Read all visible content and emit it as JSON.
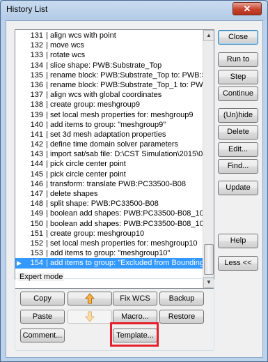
{
  "window": {
    "title": "History List",
    "close_glyph": "✕"
  },
  "history": {
    "separator": "|",
    "selected_marker": "▶",
    "items": [
      {
        "num": "131",
        "text": "align wcs with point"
      },
      {
        "num": "132",
        "text": "move wcs"
      },
      {
        "num": "133",
        "text": "rotate wcs"
      },
      {
        "num": "134",
        "text": "slice shape: PWB:Substrate_Top"
      },
      {
        "num": "135",
        "text": "rename block: PWB:Substrate_Top to: PWB:S"
      },
      {
        "num": "136",
        "text": "rename block: PWB:Substrate_Top_1 to: PWB"
      },
      {
        "num": "137",
        "text": "align wcs with global coordinates"
      },
      {
        "num": "138",
        "text": "create group: meshgroup9"
      },
      {
        "num": "139",
        "text": "set local mesh properties for: meshgroup9"
      },
      {
        "num": "140",
        "text": "add items to group: \"meshgroup9\""
      },
      {
        "num": "141",
        "text": "set 3d mesh adaptation properties"
      },
      {
        "num": "142",
        "text": "define time domain solver parameters"
      },
      {
        "num": "143",
        "text": "import sat/sab file: D:\\CST Simulation\\2015\\05"
      },
      {
        "num": "144",
        "text": "pick circle center point"
      },
      {
        "num": "145",
        "text": "pick circle center point"
      },
      {
        "num": "146",
        "text": "transform: translate PWB:PC33500-B08"
      },
      {
        "num": "147",
        "text": "delete shapes"
      },
      {
        "num": "148",
        "text": "split shape: PWB:PC33500-B08"
      },
      {
        "num": "149",
        "text": "boolean add shapes: PWB:PC33500-B08_10, I"
      },
      {
        "num": "150",
        "text": "boolean add shapes: PWB:PC33500-B08_10, I"
      },
      {
        "num": "151",
        "text": "create group: meshgroup10"
      },
      {
        "num": "152",
        "text": "set local mesh properties for: meshgroup10"
      },
      {
        "num": "153",
        "text": "add items to group: \"meshgroup10\""
      },
      {
        "num": "154",
        "text": "add items to group: \"Excluded from Bounding B"
      }
    ],
    "scroll_up_glyph": "▲",
    "scroll_down_glyph": "▼"
  },
  "side_buttons": {
    "close": "Close",
    "run_to": "Run to",
    "step": "Step",
    "continue": "Continue",
    "unhide": "(Un)hide",
    "delete": "Delete",
    "edit": "Edit...",
    "find": "Find...",
    "update": "Update",
    "help": "Help",
    "less": "Less <<"
  },
  "expert": {
    "group_label": "Expert mode",
    "copy": "Copy",
    "paste": "Paste",
    "comment": "Comment...",
    "fix_wcs": "Fix WCS",
    "macro": "Macro...",
    "template": "Template...",
    "backup": "Backup",
    "restore": "Restore",
    "move_up_icon": "arrow-up-icon",
    "move_down_icon": "arrow-down-icon",
    "highlight_color": "#e5202a"
  }
}
